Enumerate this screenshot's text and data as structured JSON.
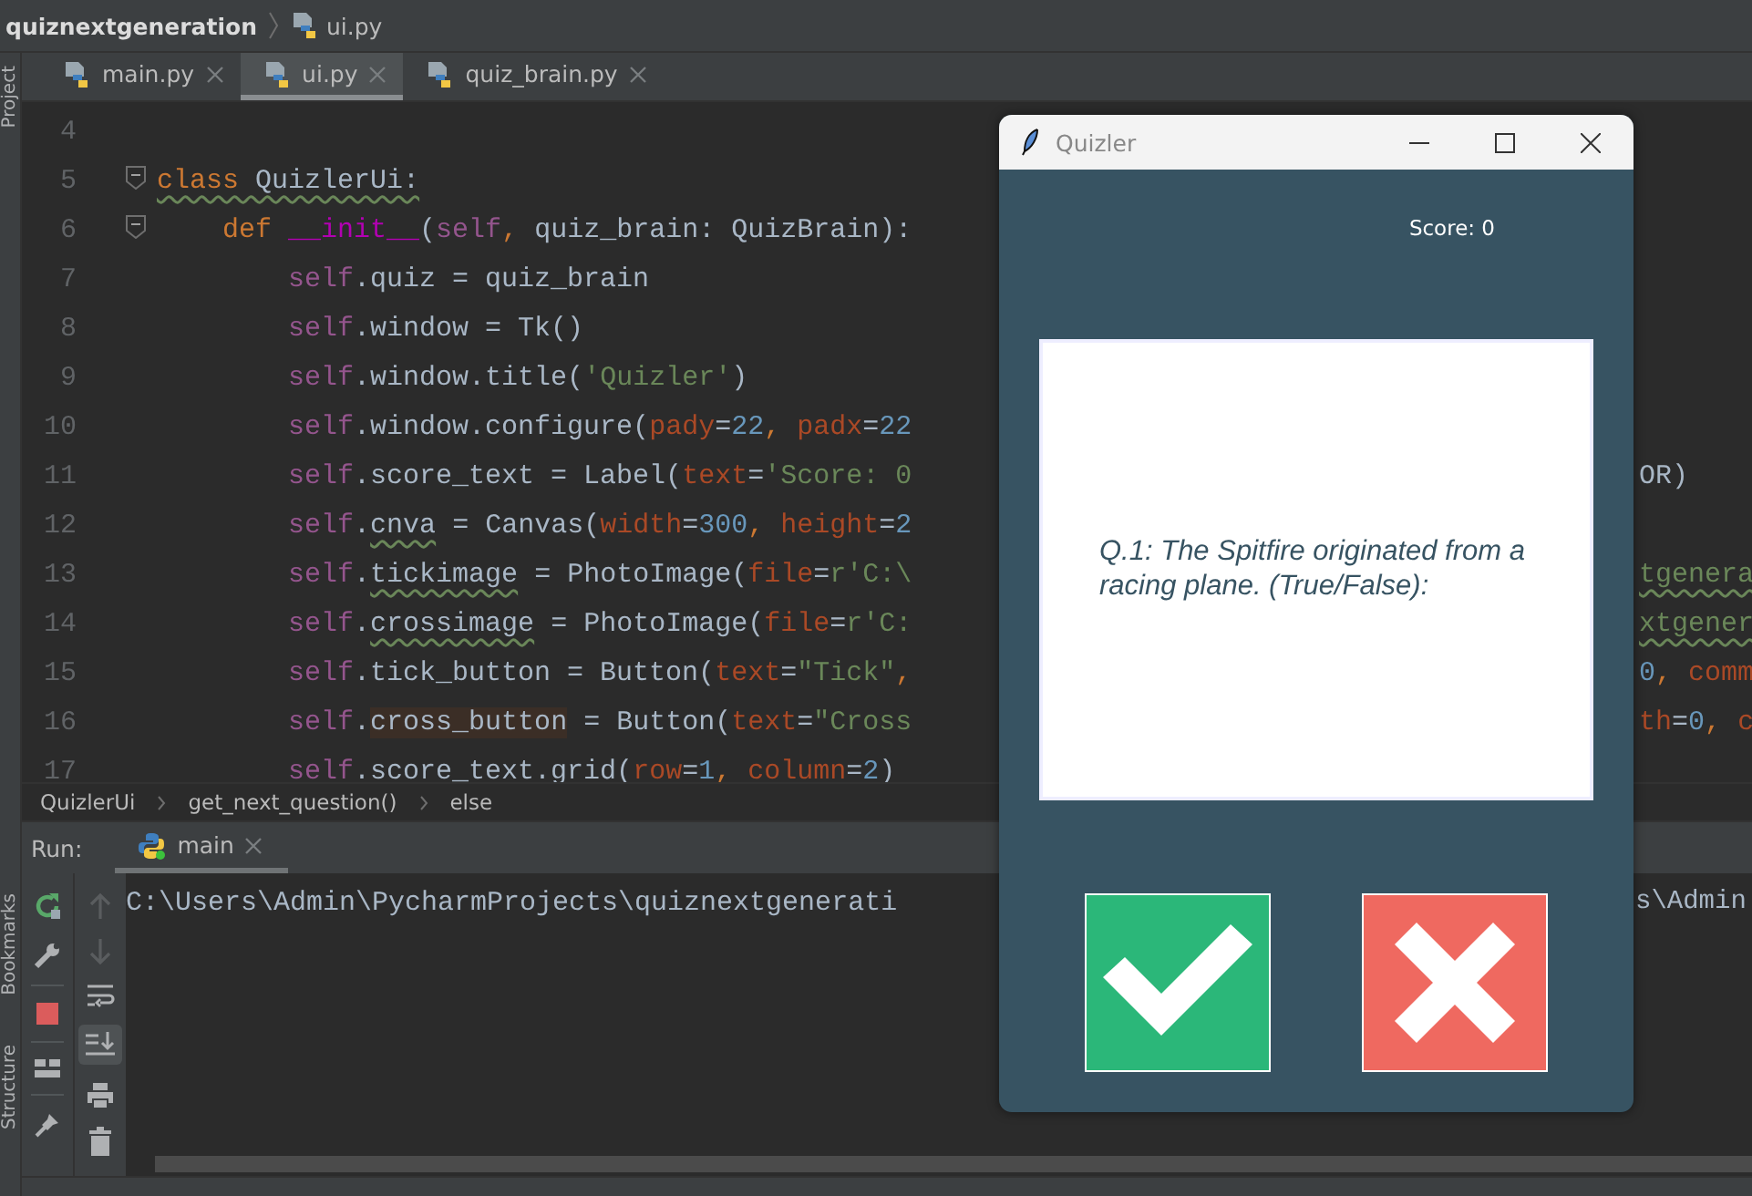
{
  "breadcrumb": {
    "project": "quiznextgeneration",
    "file": "ui.py"
  },
  "left_strip": {
    "top": [
      "Project"
    ],
    "bottom": [
      "Bookmarks",
      "Structure"
    ]
  },
  "editor_tabs": [
    {
      "label": "main.py",
      "selected": false
    },
    {
      "label": "ui.py",
      "selected": true
    },
    {
      "label": "quiz_brain.py",
      "selected": false
    }
  ],
  "code_lines": [
    {
      "number": "4",
      "fold": false
    },
    {
      "number": "5",
      "fold": true,
      "left": [
        {
          "t": "class",
          "color": "#cc7832",
          "warn": true
        },
        {
          "t": " QuizlerUi:",
          "color": "#a9b7c6",
          "warn": true
        }
      ]
    },
    {
      "number": "6",
      "fold": true,
      "left": [
        {
          "t": "    def",
          "color": "#cc7832"
        },
        {
          "t": " __init__",
          "color": "#b200b2"
        },
        {
          "t": "(",
          "color": "#a9b7c6"
        },
        {
          "t": "self",
          "color": "#94558d"
        },
        {
          "t": ",",
          "color": "#cc7832"
        },
        {
          "t": " quiz_brain: QuizBrain):",
          "color": "#a9b7c6"
        }
      ]
    },
    {
      "number": "7",
      "fold": false,
      "left": [
        {
          "t": "        self",
          "color": "#94558d"
        },
        {
          "t": ".quiz = quiz_brain",
          "color": "#a9b7c6"
        }
      ]
    },
    {
      "number": "8",
      "fold": false,
      "left": [
        {
          "t": "        self",
          "color": "#94558d"
        },
        {
          "t": ".window = Tk()",
          "color": "#a9b7c6"
        }
      ]
    },
    {
      "number": "9",
      "fold": false,
      "left": [
        {
          "t": "        self",
          "color": "#94558d"
        },
        {
          "t": ".window.title(",
          "color": "#a9b7c6"
        },
        {
          "t": "'Quizler'",
          "color": "#6a8759"
        },
        {
          "t": ")",
          "color": "#a9b7c6"
        }
      ]
    },
    {
      "number": "10",
      "fold": false,
      "left": [
        {
          "t": "        self",
          "color": "#94558d"
        },
        {
          "t": ".window.configure(",
          "color": "#a9b7c6"
        },
        {
          "t": "pady",
          "color": "#aa4926"
        },
        {
          "t": "=",
          "color": "#a9b7c6"
        },
        {
          "t": "22",
          "color": "#6897bb"
        },
        {
          "t": ",",
          "color": "#cc7832"
        },
        {
          "t": " padx",
          "color": "#aa4926"
        },
        {
          "t": "=",
          "color": "#a9b7c6"
        },
        {
          "t": "22",
          "color": "#6897bb"
        }
      ]
    },
    {
      "number": "11",
      "fold": false,
      "left": [
        {
          "t": "        self",
          "color": "#94558d"
        },
        {
          "t": ".score_text = Label(",
          "color": "#a9b7c6"
        },
        {
          "t": "text",
          "color": "#aa4926"
        },
        {
          "t": "=",
          "color": "#a9b7c6"
        },
        {
          "t": "'Score: 0",
          "color": "#6a8759"
        }
      ],
      "right": [
        {
          "t": "OR)",
          "color": "#a9b7c6"
        }
      ]
    },
    {
      "number": "12",
      "fold": false,
      "left": [
        {
          "t": "        self",
          "color": "#94558d"
        },
        {
          "t": ".",
          "color": "#a9b7c6"
        },
        {
          "t": "cnva",
          "color": "#a9b7c6",
          "warn": true
        },
        {
          "t": " = Canvas(",
          "color": "#a9b7c6"
        },
        {
          "t": "width",
          "color": "#aa4926"
        },
        {
          "t": "=",
          "color": "#a9b7c6"
        },
        {
          "t": "300",
          "color": "#6897bb"
        },
        {
          "t": ",",
          "color": "#cc7832"
        },
        {
          "t": " height",
          "color": "#aa4926"
        },
        {
          "t": "=",
          "color": "#a9b7c6"
        },
        {
          "t": "2",
          "color": "#6897bb"
        }
      ]
    },
    {
      "number": "13",
      "fold": false,
      "left": [
        {
          "t": "        self",
          "color": "#94558d"
        },
        {
          "t": ".",
          "color": "#a9b7c6"
        },
        {
          "t": "tickimage",
          "color": "#a9b7c6",
          "warn": true
        },
        {
          "t": " = PhotoImage(",
          "color": "#a9b7c6"
        },
        {
          "t": "file",
          "color": "#aa4926"
        },
        {
          "t": "=",
          "color": "#a9b7c6"
        },
        {
          "t": "r'C:\\",
          "color": "#6a8759"
        }
      ],
      "right": [
        {
          "t": "tgenera",
          "color": "#6a8759",
          "warn": true
        }
      ]
    },
    {
      "number": "14",
      "fold": false,
      "left": [
        {
          "t": "        self",
          "color": "#94558d"
        },
        {
          "t": ".",
          "color": "#a9b7c6"
        },
        {
          "t": "crossimage",
          "color": "#a9b7c6",
          "warn": true
        },
        {
          "t": " = PhotoImage(",
          "color": "#a9b7c6"
        },
        {
          "t": "file",
          "color": "#aa4926"
        },
        {
          "t": "=",
          "color": "#a9b7c6"
        },
        {
          "t": "r'C:",
          "color": "#6a8759"
        }
      ],
      "right": [
        {
          "t": "xtgener",
          "color": "#6a8759",
          "warn": true
        }
      ]
    },
    {
      "number": "15",
      "fold": false,
      "left": [
        {
          "t": "        self",
          "color": "#94558d"
        },
        {
          "t": ".tick_button = Button(",
          "color": "#a9b7c6"
        },
        {
          "t": "text",
          "color": "#aa4926"
        },
        {
          "t": "=",
          "color": "#a9b7c6"
        },
        {
          "t": "\"Tick\"",
          "color": "#6a8759"
        },
        {
          "t": ",",
          "color": "#cc7832"
        }
      ],
      "right": [
        {
          "t": "0",
          "color": "#6897bb"
        },
        {
          "t": ",",
          "color": "#cc7832"
        },
        {
          "t": " comm",
          "color": "#aa4926"
        }
      ]
    },
    {
      "number": "16",
      "fold": false,
      "left": [
        {
          "t": "        self",
          "color": "#94558d"
        },
        {
          "t": ".",
          "color": "#a9b7c6"
        },
        {
          "t": "cross_button",
          "color": "#a9b7c6",
          "hl": true
        },
        {
          "t": " = Button(",
          "color": "#a9b7c6"
        },
        {
          "t": "text",
          "color": "#aa4926"
        },
        {
          "t": "=",
          "color": "#a9b7c6"
        },
        {
          "t": "\"Cross",
          "color": "#6a8759"
        }
      ],
      "right": [
        {
          "t": "th",
          "color": "#aa4926"
        },
        {
          "t": "=",
          "color": "#a9b7c6"
        },
        {
          "t": "0",
          "color": "#6897bb"
        },
        {
          "t": ",",
          "color": "#cc7832"
        },
        {
          "t": " c",
          "color": "#aa4926"
        }
      ]
    },
    {
      "number": "17",
      "fold": false,
      "left": [
        {
          "t": "        self",
          "color": "#94558d"
        },
        {
          "t": ".score_text.grid(",
          "color": "#a9b7c6"
        },
        {
          "t": "row",
          "color": "#aa4926"
        },
        {
          "t": "=",
          "color": "#a9b7c6"
        },
        {
          "t": "1",
          "color": "#6897bb"
        },
        {
          "t": ",",
          "color": "#cc7832"
        },
        {
          "t": " column",
          "color": "#aa4926"
        },
        {
          "t": "=",
          "color": "#a9b7c6"
        },
        {
          "t": "2",
          "color": "#6897bb"
        },
        {
          "t": ")",
          "color": "#a9b7c6"
        }
      ]
    }
  ],
  "structure_path": [
    "QuizlerUi",
    "get_next_question()",
    "else"
  ],
  "run": {
    "label": "Run:",
    "tab": "main",
    "console_left": "C:\\Users\\Admin\\PycharmProjects\\quiznextgenerati",
    "console_right": "s\\Admin"
  },
  "dialog": {
    "title": "Quizler",
    "score": "Score: 0",
    "question": "Q.1: The Spitfire originated from a racing plane. (True/False):",
    "buttons": [
      {
        "kind": "tick"
      },
      {
        "kind": "cross"
      }
    ]
  }
}
